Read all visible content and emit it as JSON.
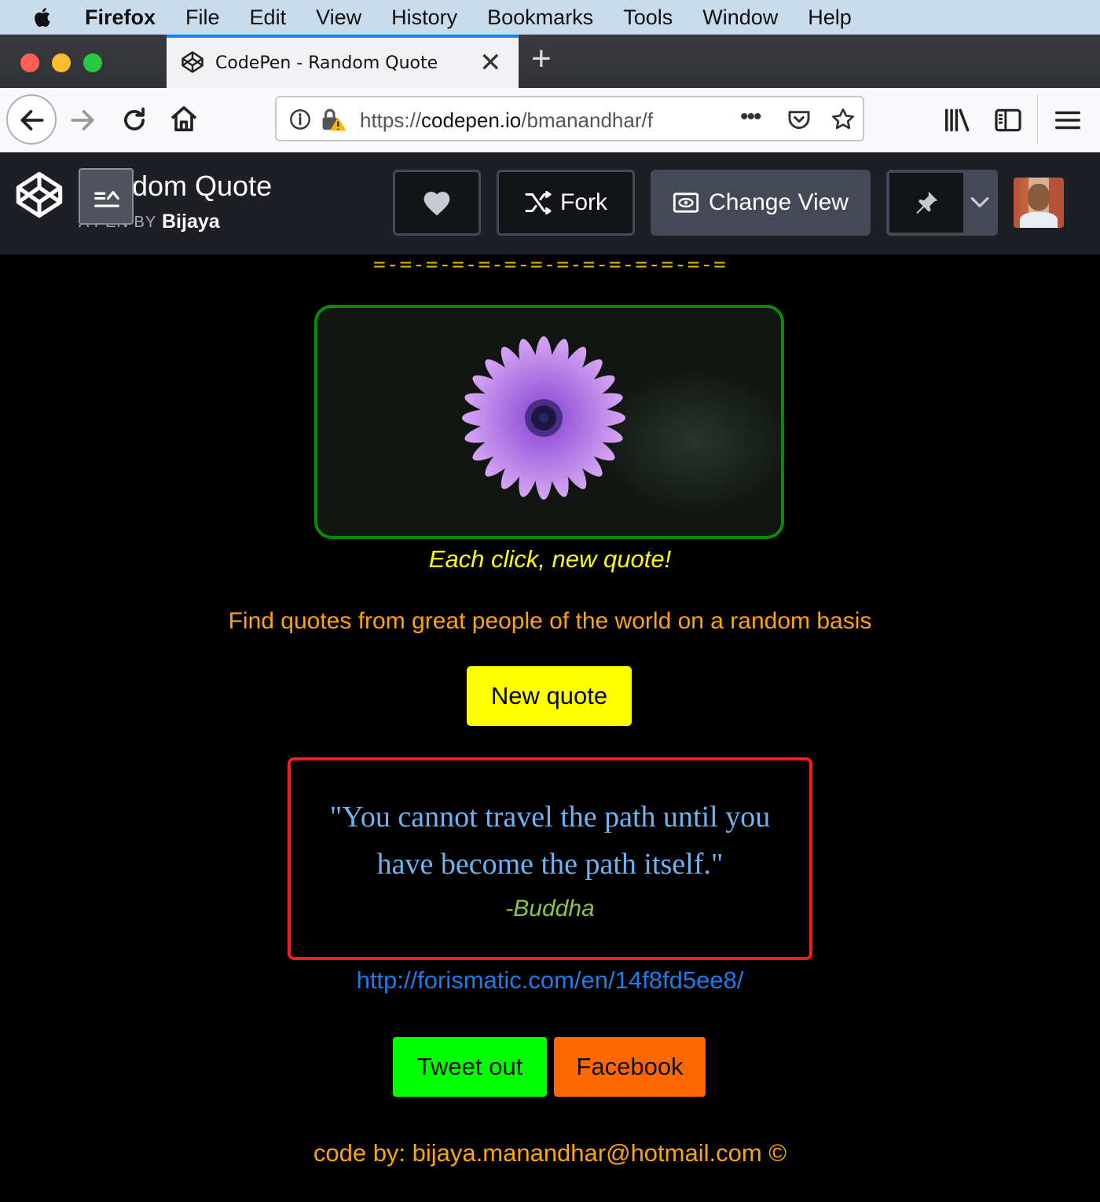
{
  "menu_bar": {
    "app": "Firefox",
    "items": [
      "File",
      "Edit",
      "View",
      "History",
      "Bookmarks",
      "Tools",
      "Window",
      "Help"
    ]
  },
  "browser": {
    "tab_title": "CodePen - Random Quote",
    "url_scheme": "https://",
    "url_host": "codepen.io",
    "url_path": "/bmanandhar/f"
  },
  "codepen": {
    "pen_title": "dom Quote",
    "byline_prefix": "A PEN BY",
    "author": "Bijaya",
    "fork_label": "Fork",
    "change_view_label": "Change View"
  },
  "page": {
    "dashes": "=-=-=-=-=-=-=-=-=-=-=-=-=-=",
    "caption": "Each click, new quote!",
    "subtitle": "Find quotes from great people of the world on a random basis",
    "new_quote_label": "New quote",
    "quote": "\"You cannot travel the path until you have become the path itself.\"",
    "quote_author": "-Buddha",
    "quote_link": "http://forismatic.com/en/14f8fd5ee8/",
    "tweet_label": "Tweet out",
    "facebook_label": "Facebook",
    "footer": "code by: bijaya.manandhar@hotmail.com ©"
  },
  "colors": {
    "tweet_button": "#00ff00",
    "facebook_button": "#ff6600",
    "new_quote_button": "#ffff00",
    "quote_border": "#ff1a1a",
    "image_border": "#0a8a0a"
  }
}
